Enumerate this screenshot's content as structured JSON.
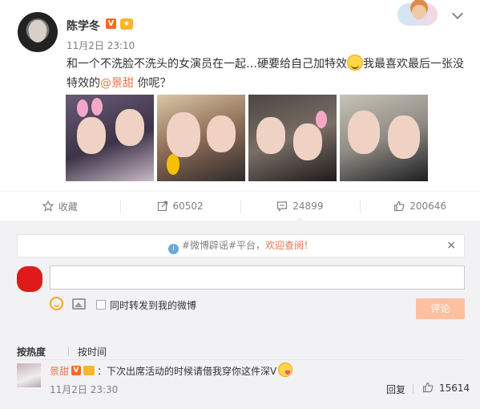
{
  "post": {
    "author": "陈学冬",
    "verified_badge": "V",
    "time": "11月2日 23:10",
    "text_before": "和一个不洗脸不洗头的女演员在一起…硬要给自己加特效",
    "text_middle": "我最喜欢最后一张没特效的",
    "mention": "@景甜",
    "text_after": " 你呢？"
  },
  "actions": [
    {
      "label": "收藏",
      "icon": "star-icon"
    },
    {
      "label": "60502",
      "icon": "forward-icon"
    },
    {
      "label": "24899",
      "icon": "comment-icon"
    },
    {
      "label": "200646",
      "icon": "like-icon"
    }
  ],
  "notice": {
    "text": "#微博辟谣#平台，",
    "highlight": "欢迎查阅！",
    "close": "×"
  },
  "composer": {
    "forward_label": "同时转发到我的微博",
    "submit_label": "评论"
  },
  "sort": {
    "hot": "按热度",
    "time": "按时间"
  },
  "comment": {
    "author": "景甜",
    "verified_badge": "V",
    "text": "：下次出席活动的时候请借我穿你这件深V",
    "time": "11月2日 23:30",
    "reply_label": "回复",
    "likes": "15614"
  },
  "colors": {
    "accent": "#eb7350",
    "submit_disabled": "#ffc09f",
    "verified": "#f36c21",
    "page_bg": "#f2f2f5"
  }
}
